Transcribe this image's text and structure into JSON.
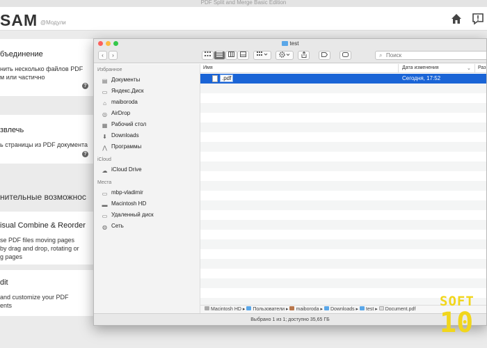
{
  "app": {
    "window_title": "PDF Split and Merge Basic Edition",
    "logo": "SAM",
    "logo_sub": "@Модули"
  },
  "cards": [
    {
      "title": "бъединение",
      "desc1": "нить несколько файлов PDF",
      "desc2": "м или частично",
      "help": "?"
    },
    {
      "title": "звлечь",
      "desc1": "ь страницы из PDF документа",
      "help": "?"
    }
  ],
  "section_title": "нительные возможнос",
  "cards2": [
    {
      "title": "isual Combine & Reorder",
      "desc1": "se PDF files moving pages",
      "desc2": "by drag and drop, rotating or",
      "desc3": "g pages"
    },
    {
      "title": "dit",
      "desc1": "and customize your PDF",
      "desc2": "ents"
    }
  ],
  "finder": {
    "title": "test",
    "search_placeholder": "Поиск",
    "sidebar": {
      "favorites_header": "Избранное",
      "favorites": [
        {
          "label": "Документы",
          "icon": "documents-icon"
        },
        {
          "label": "Яндекс.Диск",
          "icon": "folder-icon"
        },
        {
          "label": "maiboroda",
          "icon": "home-icon"
        },
        {
          "label": "AirDrop",
          "icon": "airdrop-icon"
        },
        {
          "label": "Рабочий стол",
          "icon": "desktop-icon"
        },
        {
          "label": "Downloads",
          "icon": "downloads-icon"
        },
        {
          "label": "Программы",
          "icon": "applications-icon"
        }
      ],
      "icloud_header": "iCloud",
      "icloud": [
        {
          "label": "iCloud Drive",
          "icon": "cloud-icon"
        }
      ],
      "places_header": "Места",
      "places": [
        {
          "label": "mbp-vladimir",
          "icon": "computer-icon"
        },
        {
          "label": "Macintosh HD",
          "icon": "disk-icon"
        },
        {
          "label": "Удаленный диск",
          "icon": "remote-disk-icon"
        },
        {
          "label": "Сеть",
          "icon": "network-icon"
        }
      ]
    },
    "columns": {
      "name": "Имя",
      "date": "Дата изменения",
      "size": "Раз"
    },
    "files": [
      {
        "name": ".pdf",
        "date": "Сегодня, 17:52",
        "selected": true
      }
    ],
    "path": [
      "Macintosh HD",
      "Пользователи",
      "maiboroda",
      "Downloads",
      "test",
      "Document.pdf"
    ],
    "status": "Выбрано 1 из 1; доступно 35,65 ГБ"
  },
  "watermark": {
    "top": "SOFT",
    "bottom": "10"
  },
  "colors": {
    "selection": "#1a64d6",
    "watermark": "#f1d61c",
    "close": "#fc605b",
    "minimize": "#fdbc40",
    "zoom": "#34c84a"
  }
}
